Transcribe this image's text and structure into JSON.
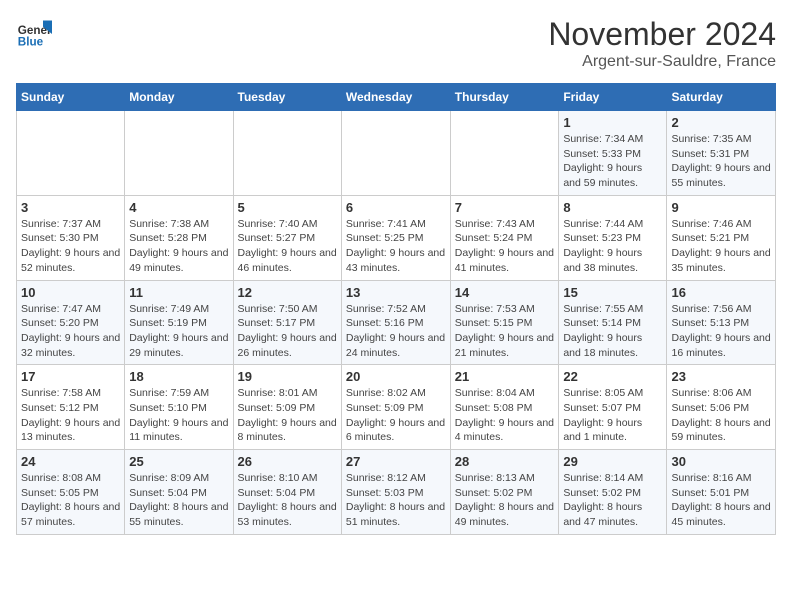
{
  "logo": {
    "text_general": "General",
    "text_blue": "Blue"
  },
  "header": {
    "month": "November 2024",
    "location": "Argent-sur-Sauldre, France"
  },
  "days_of_week": [
    "Sunday",
    "Monday",
    "Tuesday",
    "Wednesday",
    "Thursday",
    "Friday",
    "Saturday"
  ],
  "weeks": [
    [
      {
        "day": "",
        "info": ""
      },
      {
        "day": "",
        "info": ""
      },
      {
        "day": "",
        "info": ""
      },
      {
        "day": "",
        "info": ""
      },
      {
        "day": "",
        "info": ""
      },
      {
        "day": "1",
        "info": "Sunrise: 7:34 AM\nSunset: 5:33 PM\nDaylight: 9 hours and 59 minutes."
      },
      {
        "day": "2",
        "info": "Sunrise: 7:35 AM\nSunset: 5:31 PM\nDaylight: 9 hours and 55 minutes."
      }
    ],
    [
      {
        "day": "3",
        "info": "Sunrise: 7:37 AM\nSunset: 5:30 PM\nDaylight: 9 hours and 52 minutes."
      },
      {
        "day": "4",
        "info": "Sunrise: 7:38 AM\nSunset: 5:28 PM\nDaylight: 9 hours and 49 minutes."
      },
      {
        "day": "5",
        "info": "Sunrise: 7:40 AM\nSunset: 5:27 PM\nDaylight: 9 hours and 46 minutes."
      },
      {
        "day": "6",
        "info": "Sunrise: 7:41 AM\nSunset: 5:25 PM\nDaylight: 9 hours and 43 minutes."
      },
      {
        "day": "7",
        "info": "Sunrise: 7:43 AM\nSunset: 5:24 PM\nDaylight: 9 hours and 41 minutes."
      },
      {
        "day": "8",
        "info": "Sunrise: 7:44 AM\nSunset: 5:23 PM\nDaylight: 9 hours and 38 minutes."
      },
      {
        "day": "9",
        "info": "Sunrise: 7:46 AM\nSunset: 5:21 PM\nDaylight: 9 hours and 35 minutes."
      }
    ],
    [
      {
        "day": "10",
        "info": "Sunrise: 7:47 AM\nSunset: 5:20 PM\nDaylight: 9 hours and 32 minutes."
      },
      {
        "day": "11",
        "info": "Sunrise: 7:49 AM\nSunset: 5:19 PM\nDaylight: 9 hours and 29 minutes."
      },
      {
        "day": "12",
        "info": "Sunrise: 7:50 AM\nSunset: 5:17 PM\nDaylight: 9 hours and 26 minutes."
      },
      {
        "day": "13",
        "info": "Sunrise: 7:52 AM\nSunset: 5:16 PM\nDaylight: 9 hours and 24 minutes."
      },
      {
        "day": "14",
        "info": "Sunrise: 7:53 AM\nSunset: 5:15 PM\nDaylight: 9 hours and 21 minutes."
      },
      {
        "day": "15",
        "info": "Sunrise: 7:55 AM\nSunset: 5:14 PM\nDaylight: 9 hours and 18 minutes."
      },
      {
        "day": "16",
        "info": "Sunrise: 7:56 AM\nSunset: 5:13 PM\nDaylight: 9 hours and 16 minutes."
      }
    ],
    [
      {
        "day": "17",
        "info": "Sunrise: 7:58 AM\nSunset: 5:12 PM\nDaylight: 9 hours and 13 minutes."
      },
      {
        "day": "18",
        "info": "Sunrise: 7:59 AM\nSunset: 5:10 PM\nDaylight: 9 hours and 11 minutes."
      },
      {
        "day": "19",
        "info": "Sunrise: 8:01 AM\nSunset: 5:09 PM\nDaylight: 9 hours and 8 minutes."
      },
      {
        "day": "20",
        "info": "Sunrise: 8:02 AM\nSunset: 5:09 PM\nDaylight: 9 hours and 6 minutes."
      },
      {
        "day": "21",
        "info": "Sunrise: 8:04 AM\nSunset: 5:08 PM\nDaylight: 9 hours and 4 minutes."
      },
      {
        "day": "22",
        "info": "Sunrise: 8:05 AM\nSunset: 5:07 PM\nDaylight: 9 hours and 1 minute."
      },
      {
        "day": "23",
        "info": "Sunrise: 8:06 AM\nSunset: 5:06 PM\nDaylight: 8 hours and 59 minutes."
      }
    ],
    [
      {
        "day": "24",
        "info": "Sunrise: 8:08 AM\nSunset: 5:05 PM\nDaylight: 8 hours and 57 minutes."
      },
      {
        "day": "25",
        "info": "Sunrise: 8:09 AM\nSunset: 5:04 PM\nDaylight: 8 hours and 55 minutes."
      },
      {
        "day": "26",
        "info": "Sunrise: 8:10 AM\nSunset: 5:04 PM\nDaylight: 8 hours and 53 minutes."
      },
      {
        "day": "27",
        "info": "Sunrise: 8:12 AM\nSunset: 5:03 PM\nDaylight: 8 hours and 51 minutes."
      },
      {
        "day": "28",
        "info": "Sunrise: 8:13 AM\nSunset: 5:02 PM\nDaylight: 8 hours and 49 minutes."
      },
      {
        "day": "29",
        "info": "Sunrise: 8:14 AM\nSunset: 5:02 PM\nDaylight: 8 hours and 47 minutes."
      },
      {
        "day": "30",
        "info": "Sunrise: 8:16 AM\nSunset: 5:01 PM\nDaylight: 8 hours and 45 minutes."
      }
    ]
  ]
}
